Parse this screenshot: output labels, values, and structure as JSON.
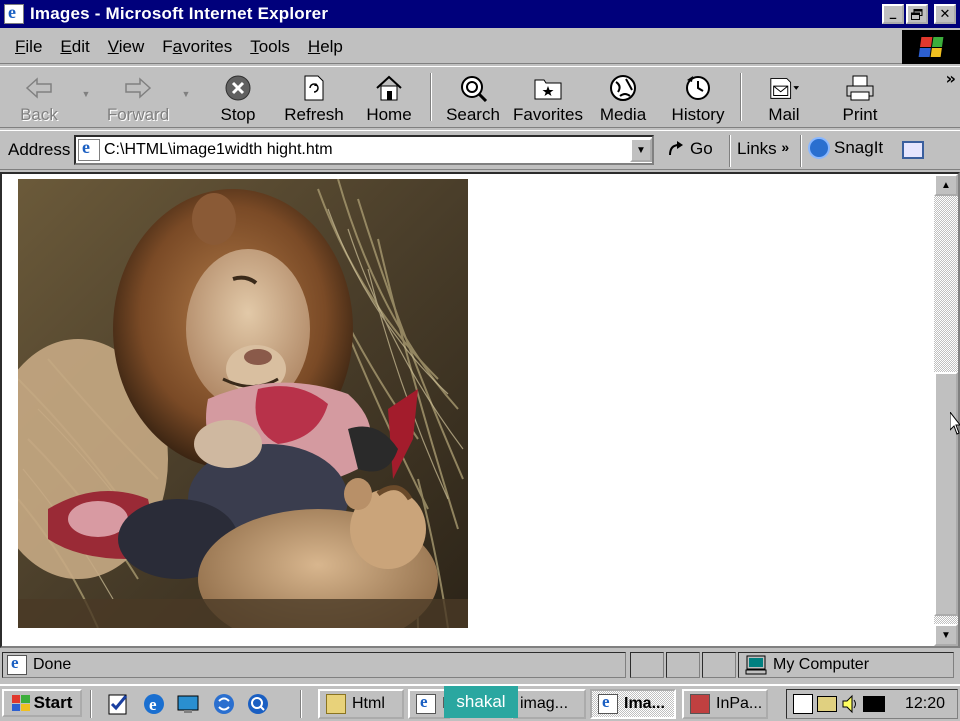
{
  "window": {
    "title": "Images - Microsoft Internet Explorer",
    "controls": [
      "_",
      "▯",
      "✕"
    ]
  },
  "menu": {
    "items": [
      {
        "label": "File",
        "accel": "F",
        "rest": "ile"
      },
      {
        "label": "Edit",
        "accel": "E",
        "rest": "dit"
      },
      {
        "label": "View",
        "accel": "V",
        "rest": "iew"
      },
      {
        "label": "Favorites",
        "accel": "a",
        "pre": "F",
        "rest": "vorites"
      },
      {
        "label": "Tools",
        "accel": "T",
        "rest": "ools"
      },
      {
        "label": "Help",
        "accel": "H",
        "rest": "elp"
      }
    ]
  },
  "toolbar": {
    "back": "Back",
    "forward": "Forward",
    "stop": "Stop",
    "refresh": "Refresh",
    "home": "Home",
    "search": "Search",
    "favorites": "Favorites",
    "media": "Media",
    "history": "History",
    "mail": "Mail",
    "print": "Print",
    "more": "»"
  },
  "address": {
    "label": "Address",
    "url": "C:\\HTML\\image1width hight.htm",
    "go": "Go",
    "links": "Links",
    "links_more": "»",
    "snagit": "SnagIt"
  },
  "content": {
    "image_description_name": "lion-photo"
  },
  "status": {
    "text": "Done",
    "zone": "My Computer"
  },
  "taskbar": {
    "start": "Start",
    "tasks": [
      {
        "label": "Html",
        "icon": "folder-icon",
        "active": false
      },
      {
        "label": "I",
        "icon": "ie-icon",
        "active": false
      },
      {
        "label": "imag...",
        "icon": "ie-icon",
        "active": false
      },
      {
        "label": "Ima...",
        "icon": "ie-icon",
        "active": true
      },
      {
        "label": "InPa...",
        "icon": "app-icon",
        "active": false
      }
    ],
    "tooltip": "shakal",
    "clock": "12:20"
  }
}
